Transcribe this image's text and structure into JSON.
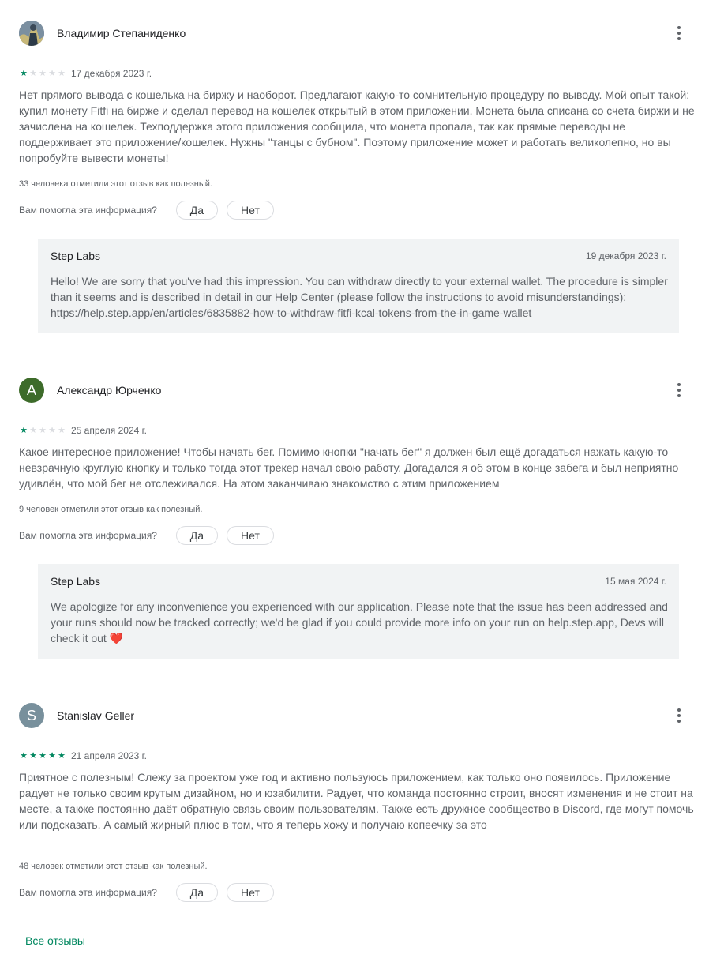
{
  "reviews": [
    {
      "author": "Владимир Степаниденко",
      "avatar_letter": "",
      "avatar_color": "#6b7b8a",
      "rating": 1,
      "date": "17 декабря 2023 г.",
      "text": "Нет прямого вывода с кошелька на биржу и наоборот. Предлагают какую-то сомнительную процедуру по выводу. Мой опыт такой: купил монету Fitfi на бирже и сделал перевод на кошелек открытый в этом приложении. Монета была списана со счета биржи и не зачислена на кошелек. Техподдержка этого приложения сообщила, что монета пропала, так как прямые переводы не поддерживает это приложение/кошелек. Нужны \"танцы с бубном\". Поэтому приложение может и работать великолепно, но вы попробуйте вывести монеты!",
      "helpful": "33 человека отметили этот отзыв как полезный.",
      "question": "Вам помогла эта информация?",
      "yes": "Да",
      "no": "Нет",
      "reply": {
        "developer": "Step Labs",
        "date": "19 декабря 2023 г.",
        "text": "Hello! We are sorry that you've had this impression. You can withdraw directly to your external wallet. The procedure is simpler than it seems and is described in detail in our Help Center (please follow the instructions to avoid misunderstandings): https://help.step.app/en/articles/6835882-how-to-withdraw-fitfi-kcal-tokens-from-the-in-game-wallet"
      }
    },
    {
      "author": "Александр Юрченко",
      "avatar_letter": "A",
      "avatar_color": "#3d6b2a",
      "rating": 1,
      "date": "25 апреля 2024 г.",
      "text": "Какое интересное приложение! Чтобы начать бег. Помимо кнопки \"начать бег\" я должен был ещё догадаться нажать какую-то невзрачную круглую кнопку и только тогда этот трекер начал свою работу. Догадался я об этом в конце забега и был неприятно удивлён, что мой бег не отслеживался. На этом заканчиваю знакомство с этим приложением",
      "helpful": "9 человек отметили этот отзыв как полезный.",
      "question": "Вам помогла эта информация?",
      "yes": "Да",
      "no": "Нет",
      "reply": {
        "developer": "Step Labs",
        "date": "15 мая 2024 г.",
        "text": "We apologize for any inconvenience you experienced with our application. Please note that the issue has been addressed and your runs should now be tracked correctly; we'd be glad if you could provide more info on your run on help.step.app, Devs will check it out",
        "emoji": "❤️"
      }
    },
    {
      "author": "Stanislav Geller",
      "avatar_letter": "S",
      "avatar_color": "#78909c",
      "rating": 5,
      "date": "21 апреля 2023 г.",
      "text": "Приятное с полезным! Слежу за проектом уже год и активно пользуюсь приложением, как только оно появилось. Приложение радует не только своим крутым дизайном, но и юзабилити. Радует, что команда постоянно строит, вносят изменения и не стоит на месте, а также постоянно даёт обратную связь своим пользователям. Также есть дружное сообщество в Discord, где могут помочь или подсказать. А самый жирный плюс в том, что я теперь хожу и получаю копеечку за это",
      "helpful": "48 человек отметили этот отзыв как полезный.",
      "question": "Вам помогла эта информация?",
      "yes": "Да",
      "no": "Нет"
    }
  ],
  "all_reviews_label": "Все отзывы",
  "colors": {
    "accent": "#01875f",
    "star_off": "#dadce0",
    "reply_bg": "#f1f3f4"
  }
}
